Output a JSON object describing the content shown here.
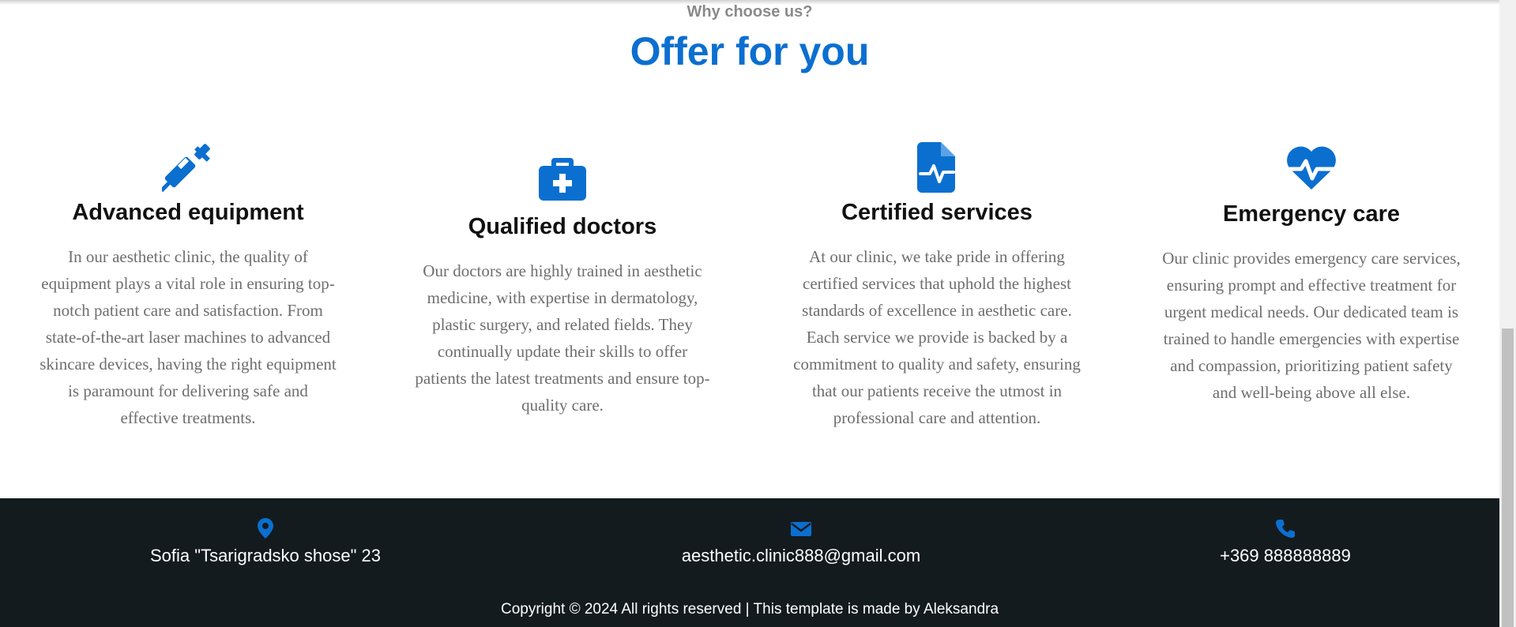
{
  "section": {
    "eyebrow": "Why choose us?",
    "title": "Offer for you"
  },
  "features": [
    {
      "icon": "syringe-icon",
      "title": "Advanced equipment",
      "text": "In our aesthetic clinic, the quality of equipment plays a vital role in ensuring top-notch patient care and satisfaction. From state-of-the-art laser machines to advanced skincare devices, having the right equipment is paramount for delivering safe and effective treatments."
    },
    {
      "icon": "medical-kit-icon",
      "title": "Qualified doctors",
      "text": "Our doctors are highly trained in aesthetic medicine, with expertise in dermatology, plastic surgery, and related fields. They continually update their skills to offer patients the latest treatments and ensure top-quality care."
    },
    {
      "icon": "medical-file-icon",
      "title": "Certified services",
      "text": "At our clinic, we take pride in offering certified services that uphold the highest standards of excellence in aesthetic care. Each service we provide is backed by a commitment to quality and safety, ensuring that our patients receive the utmost in professional care and attention."
    },
    {
      "icon": "heart-pulse-icon",
      "title": "Emergency care",
      "text": "Our clinic provides emergency care services, ensuring prompt and effective treatment for urgent medical needs. Our dedicated team is trained to handle emergencies with expertise and compassion, prioritizing patient safety and well-being above all else."
    }
  ],
  "footer": {
    "address": "Sofia \"Tsarigradsko shose\" 23",
    "email": "aesthetic.clinic888@gmail.com",
    "phone": "+369 888888889",
    "copyright": "Copyright © 2024 All rights reserved | This template is made by Aleksandra",
    "icons": [
      "map-marker-icon",
      "envelope-icon",
      "phone-icon"
    ]
  },
  "colors": {
    "accent": "#0b6fd0",
    "footer_bg": "#141b1f",
    "body_text": "#6e6e6e",
    "heading_text": "#111111"
  }
}
